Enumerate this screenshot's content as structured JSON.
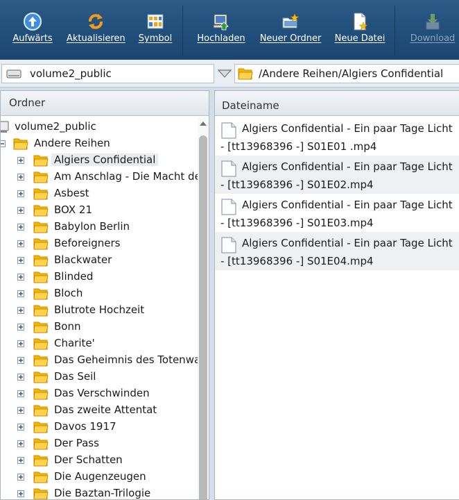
{
  "toolbar": {
    "buttons": [
      {
        "label": "Aufwärts",
        "icon": "arrow-up-icon"
      },
      {
        "label": "Aktualisieren",
        "icon": "refresh-icon"
      },
      {
        "label": "Symbol",
        "icon": "grid-view-icon"
      },
      {
        "label": "Hochladen",
        "icon": "upload-icon"
      },
      {
        "label": "Neuer Ordner",
        "icon": "new-folder-icon"
      },
      {
        "label": "Neue Datei",
        "icon": "new-file-icon"
      },
      {
        "label": "Download",
        "icon": "download-icon",
        "disabled": true
      }
    ]
  },
  "location": {
    "volume": "volume2_public",
    "path": "/Andere Reihen/Algiers Confidential"
  },
  "left_panel": {
    "header": "Ordner",
    "root": "volume2_public",
    "parent": "Andere Reihen",
    "selected": "Algiers Confidential",
    "folders": [
      "Algiers Confidential",
      "Am Anschlag - Die Macht de",
      "Asbest",
      "BOX 21",
      "Babylon Berlin",
      "Beforeigners",
      "Blackwater",
      "Blinded",
      "Bloch",
      "Blutrote Hochzeit",
      "Bonn",
      "Charite'",
      "Das Geheimnis des Totenwa",
      "Das Seil",
      "Das Verschwinden",
      "Das zweite Attentat",
      "Davos 1917",
      "Der Pass",
      "Der Schatten",
      "Die Augenzeugen",
      "Die Baztan-Trilogie"
    ]
  },
  "right_panel": {
    "header": "Dateiname",
    "files": [
      "Algiers Confidential - Ein paar Tage Licht - [tt13968396 -] S01E01 .mp4",
      "Algiers Confidential - Ein paar Tage Licht - [tt13968396 -] S01E02.mp4",
      "Algiers Confidential - Ein paar Tage Licht - [tt13968396 -] S01E03.mp4",
      "Algiers Confidential - Ein paar Tage Licht - [tt13968396 -] S01E04.mp4"
    ]
  },
  "colors": {
    "toolbar_bg": "#22507d",
    "folder_yellow": "#f5b800",
    "selection_bg": "#e9ecef"
  }
}
